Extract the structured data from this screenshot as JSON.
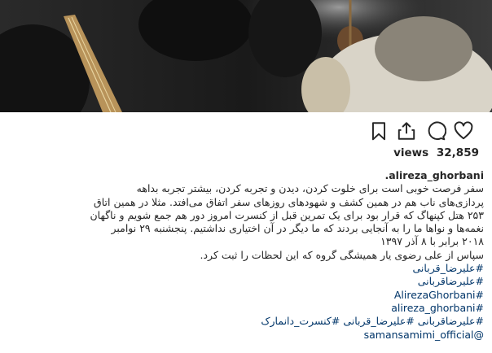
{
  "media": {
    "kind": "video-still",
    "description_icon": "musicians-rehearsal-image"
  },
  "actions": {
    "like_icon": "heart-icon",
    "comment_icon": "comment-icon",
    "share_icon": "share-icon",
    "save_icon": "bookmark-icon"
  },
  "stats": {
    "views_label": "views",
    "views_count": "32,859"
  },
  "caption": {
    "username": "alireza_ghorbani.",
    "lines": [
      "سفر فرصت خوبی است برای خلوت کردن، دیدن و تجربه کردن، بیشتر تجربه بداهه",
      "پردازی‌های ناب هم در همین کشف و شهودهای روزهای سفر اتفاق می‌افتد. مثلا در همین اتاق",
      "۲۵۳ هتل کپنهاگ که قرار بود برای یک تمرین قبل از کنسرت امروز دور هم جمع شویم و ناگهان",
      "نغمه‌ها و نواها ما را به آنجایی بردند که ما دیگر در آن اختیاری نداشتیم. پنجشنبه ۲۹ نوامبر",
      "۲۰۱۸ برابر با ۸ آذر ۱۳۹۷",
      "سپاس از علی رضوی یار همیشگی گروه که این لحظات را ثبت کرد."
    ],
    "tags": [
      "#علیرضا_قربانی",
      "#علیرضاقربانی",
      "#AlirezaGhorbani",
      "#alireza_ghorbani",
      "#علیرضاقربانی #علیرضا_قربانی #کنسرت_دانمارک",
      "@samansamimi_official"
    ]
  },
  "colors": {
    "text": "#262626",
    "link": "#003569",
    "background": "#ffffff"
  }
}
